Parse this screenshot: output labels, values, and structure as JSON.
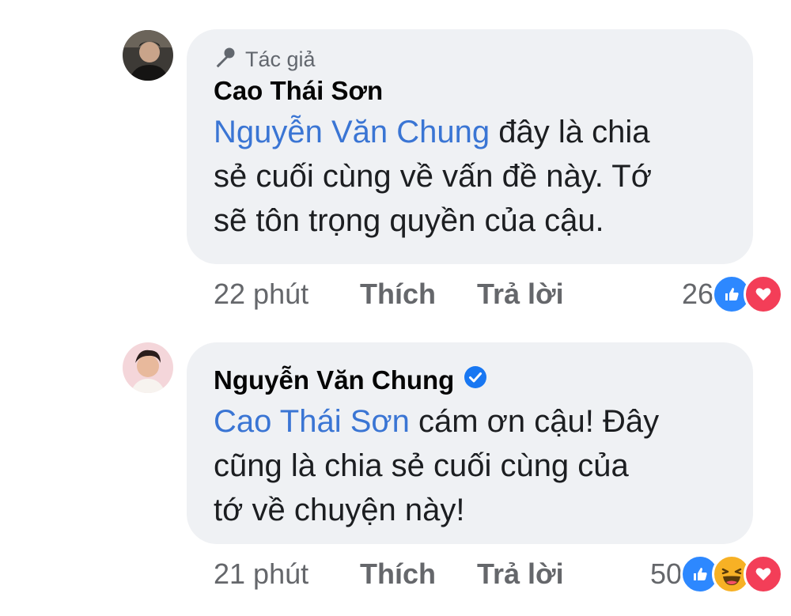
{
  "comments": [
    {
      "author_badge": "Tác giả",
      "author": "Cao Thái Sơn",
      "mention": "Nguyễn Văn Chung",
      "text_line1": " đây là chia",
      "text_line2": "sẻ cuối cùng về vấn đề này. Tớ",
      "text_line3": "sẽ tôn trọng quyền của cậu.",
      "time": "22 phút",
      "like_label": "Thích",
      "reply_label": "Trả lời",
      "reaction_count": "26",
      "reactions": [
        "like",
        "love"
      ]
    },
    {
      "author": "Nguyễn Văn Chung",
      "verified": true,
      "mention": "Cao Thái Sơn",
      "text_line1": " cám ơn cậu! Đây",
      "text_line2": "cũng là chia sẻ cuối cùng của",
      "text_line3": "tớ về chuyện này!",
      "time": "21 phút",
      "like_label": "Thích",
      "reply_label": "Trả lời",
      "reaction_count": "50",
      "reactions": [
        "like",
        "haha",
        "love"
      ]
    }
  ],
  "colors": {
    "bubble": "#eff1f4",
    "mention": "#3a75d4",
    "meta": "#65676b",
    "like": "#2d88ff",
    "love": "#f33e58",
    "haha": "#f7b125",
    "verified": "#1877f2"
  }
}
